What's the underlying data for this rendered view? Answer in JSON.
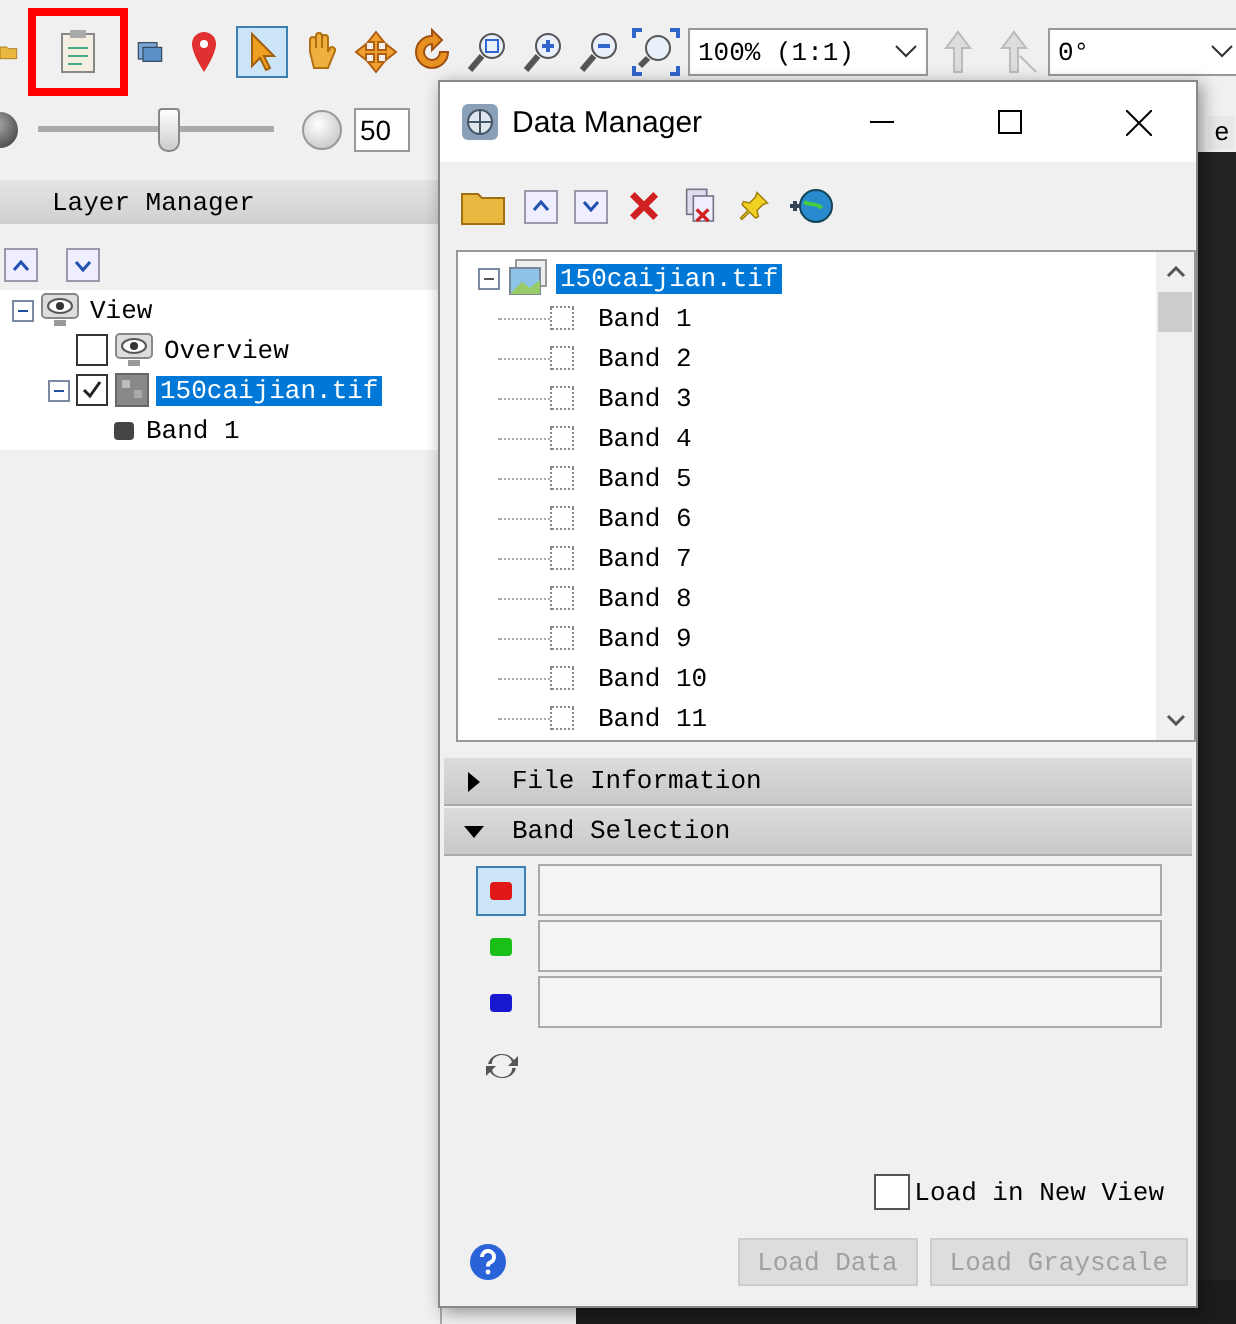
{
  "toolbar": {
    "zoom_combo": {
      "value": "100% (1:1)"
    },
    "rotation_combo": {
      "value": "0°"
    }
  },
  "opacity_slider": {
    "level": 0.55,
    "value": "50"
  },
  "partial_tab": {
    "label": "e"
  },
  "layer_manager": {
    "title": "Layer Manager",
    "tree": [
      {
        "label": "View",
        "kind": "view",
        "expanded": true,
        "selected": false,
        "children": [
          {
            "label": "Overview",
            "kind": "view",
            "checked": false,
            "selected": false
          },
          {
            "label": "150caijian.tif",
            "kind": "raster",
            "checked": true,
            "expanded": true,
            "selected": true,
            "children": [
              {
                "label": "Band 1",
                "kind": "band",
                "selected": false
              }
            ]
          }
        ]
      }
    ]
  },
  "data_manager": {
    "title": "Data Manager",
    "tree": {
      "label": "150caijian.tif",
      "expanded": true,
      "selected": true,
      "children": [
        {
          "label": "Band 1",
          "checked": false
        },
        {
          "label": "Band 2",
          "checked": false
        },
        {
          "label": "Band 3",
          "checked": false
        },
        {
          "label": "Band 4",
          "checked": false
        },
        {
          "label": "Band 5",
          "checked": false
        },
        {
          "label": "Band 6",
          "checked": false
        },
        {
          "label": "Band 7",
          "checked": false
        },
        {
          "label": "Band 8",
          "checked": false
        },
        {
          "label": "Band 9",
          "checked": false
        },
        {
          "label": "Band 10",
          "checked": false
        },
        {
          "label": "Band 11",
          "checked": false
        }
      ]
    },
    "sections": [
      {
        "title": "File Information",
        "expanded": false
      },
      {
        "title": "Band Selection",
        "expanded": true
      }
    ],
    "channels": [
      {
        "color": "#e01818",
        "selected": true
      },
      {
        "color": "#18c018",
        "selected": false
      },
      {
        "color": "#1818d0",
        "selected": false
      }
    ],
    "load_in_new_view": {
      "label": "Load in New View",
      "checked": false
    },
    "buttons": [
      {
        "label": "Load Data",
        "disabled": true
      },
      {
        "label": "Load Grayscale",
        "disabled": true
      }
    ]
  }
}
